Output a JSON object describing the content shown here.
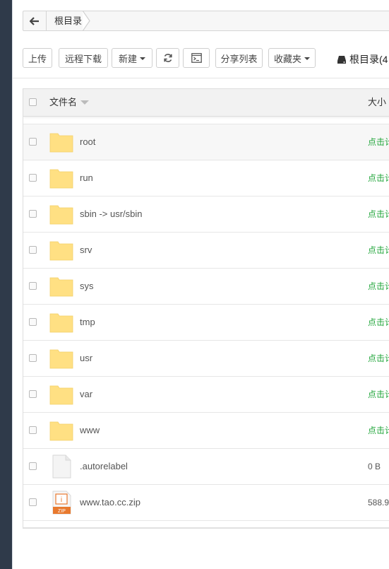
{
  "breadcrumb": {
    "root_label": "根目录"
  },
  "toolbar": {
    "upload": "上传",
    "remote_download": "远程下载",
    "new": "新建",
    "share_list": "分享列表",
    "favorites": "收藏夹",
    "disk_label": "根目录(4"
  },
  "table": {
    "col_name": "文件名",
    "col_size": "大小",
    "rows": [
      {
        "name": "",
        "type": "folder",
        "size": "",
        "partial": true
      },
      {
        "name": "root",
        "type": "folder",
        "size": "点击计",
        "highlight": true
      },
      {
        "name": "run",
        "type": "folder",
        "size": "点击计"
      },
      {
        "name": "sbin -> usr/sbin",
        "type": "folder",
        "size": "点击计"
      },
      {
        "name": "srv",
        "type": "folder",
        "size": "点击计"
      },
      {
        "name": "sys",
        "type": "folder",
        "size": "点击计"
      },
      {
        "name": "tmp",
        "type": "folder",
        "size": "点击计"
      },
      {
        "name": "usr",
        "type": "folder",
        "size": "点击计"
      },
      {
        "name": "var",
        "type": "folder",
        "size": "点击计"
      },
      {
        "name": "www",
        "type": "folder",
        "size": "点击计"
      },
      {
        "name": ".autorelabel",
        "type": "file",
        "size": "0 B"
      },
      {
        "name": "www.tao.cc.zip",
        "type": "zip",
        "size": "588.9"
      }
    ]
  },
  "icons": {
    "back": "arrow-left-icon",
    "refresh": "refresh-icon",
    "terminal": "terminal-icon",
    "disk": "hard-drive-icon",
    "folder": "folder-icon",
    "file": "file-icon",
    "zip": "zip-file-icon"
  },
  "colors": {
    "folder": "#ffe083",
    "green_size": "#20a53a",
    "zip_orange": "#e8792e"
  }
}
